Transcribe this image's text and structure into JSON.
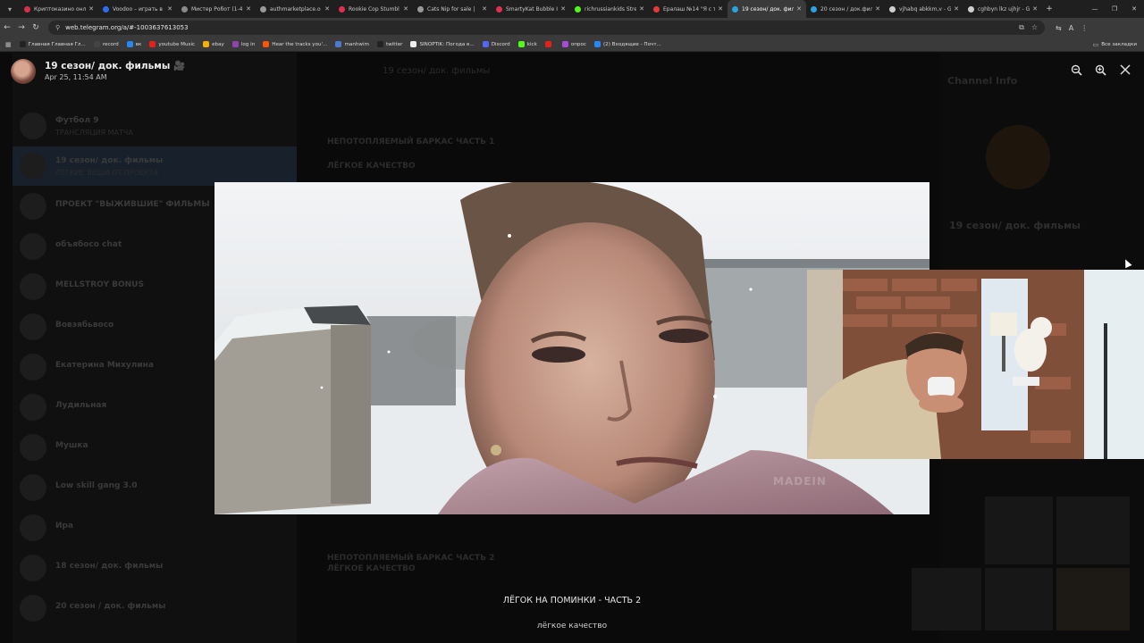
{
  "browser": {
    "tabs": [
      {
        "title": "Криптоказино онл",
        "color": "#d9304a"
      },
      {
        "title": "Voodoo – играть в",
        "color": "#2d6df0"
      },
      {
        "title": "Мистер Робот (1-4",
        "color": "#8a8a8a"
      },
      {
        "title": "authmarketplace.o",
        "color": "#9a9a9a"
      },
      {
        "title": "Rookie Cop Stumbl",
        "color": "#e03050"
      },
      {
        "title": "Cats Nip for sale |",
        "color": "#9a9a9a"
      },
      {
        "title": "SmartyKat Bubble I",
        "color": "#e03050"
      },
      {
        "title": "richrussiankids Stre",
        "color": "#53fc18"
      },
      {
        "title": "Ералаш №14 \"Я с т",
        "color": "#e53935"
      },
      {
        "title": "19 сезон/ док. фил",
        "color": "#2aa3e0",
        "active": true
      },
      {
        "title": "20 сезон / док.фил",
        "color": "#2aa3e0"
      },
      {
        "title": "vjhabq abkkm,v - G",
        "color": "#cfcfcf"
      },
      {
        "title": "cghbyn lkz ujhjr - G",
        "color": "#cfcfcf"
      }
    ],
    "address": "web.telegram.org/a/#-1003637613053",
    "bookmarks": [
      {
        "label": "Главная Главная Гл...",
        "color": "#222"
      },
      {
        "label": "record",
        "color": "#444"
      },
      {
        "label": "вк",
        "color": "#2787f5"
      },
      {
        "label": "youtube Music",
        "color": "#e62117"
      },
      {
        "label": "ebay",
        "color": "#f5af02"
      },
      {
        "label": "log in",
        "color": "#8e44ad"
      },
      {
        "label": "Hear the tracks you'...",
        "color": "#ff5500"
      },
      {
        "label": "manhwim",
        "color": "#4a7bd0"
      },
      {
        "label": "twitter",
        "color": "#222"
      },
      {
        "label": "SINOPTIK: Погода в...",
        "color": "#eee"
      },
      {
        "label": "Discord",
        "color": "#5865f2"
      },
      {
        "label": "kick",
        "color": "#53fc18"
      },
      {
        "label": "",
        "color": "#e62117"
      },
      {
        "label": "опрос",
        "color": "#a84bd8"
      },
      {
        "label": "(2) Входящие - Почт...",
        "color": "#2787f5"
      }
    ],
    "all_bookmarks": "Все закладки"
  },
  "viewer": {
    "sender_name": "19 сезон/ док. фильмы 🎥",
    "date": "Apr 25, 11:54 AM",
    "caption_title": "ЛЁГОК НА ПОМИНКИ - ЧАСТЬ 2",
    "caption_sub": "лёгкое качество",
    "watermark": "MADEIN"
  },
  "background": {
    "chat_title": "19 сезон/ док. фильмы",
    "right_title": "Channel Info",
    "right_name": "19 сезон/ док. фильмы",
    "chats": [
      {
        "name": "Футбол 9",
        "preview": "ТРАНСЛЯЦИЯ МАТЧА"
      },
      {
        "name": "19 сезон/ док. фильмы",
        "preview": "ЛЁГКИЕ ВЕЩИ ОТ ПРОЕКТА",
        "selected": true
      },
      {
        "name": "ПРОЕКТ \"ВЫЖИВШИЕ\" ФИЛЬМЫ",
        "preview": ""
      },
      {
        "name": "объябосо chat",
        "preview": ""
      },
      {
        "name": "MELLSTROY BONUS",
        "preview": ""
      },
      {
        "name": "Вовэябьвосо",
        "preview": ""
      },
      {
        "name": "Екатерина Михулина",
        "preview": ""
      },
      {
        "name": "Лудильная",
        "preview": ""
      },
      {
        "name": "Мушка",
        "preview": ""
      },
      {
        "name": "Low skill gang 3.0",
        "preview": ""
      },
      {
        "name": "Ира",
        "preview": ""
      },
      {
        "name": "18 сезон/ док. фильмы",
        "preview": ""
      },
      {
        "name": "20 сезон / док. фильмы",
        "preview": ""
      }
    ],
    "messages": [
      "НЕПОТОПЛЯЕМЫЙ БАРКАС ЧАСТЬ 1",
      "ЛЁГКОЕ КАЧЕСТВО",
      "НЕПОТОПЛЯЕМЫЙ БАРКАС ЧАСТЬ 2",
      "ЛЁГКОЕ КАЧЕСТВО"
    ]
  }
}
